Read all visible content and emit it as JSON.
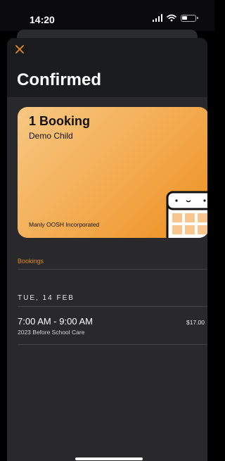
{
  "status_bar": {
    "time": "14:20"
  },
  "header": {
    "title": "Confirmed",
    "close_icon": "close-icon"
  },
  "card": {
    "title": "1 Booking",
    "subtitle": "Demo Child",
    "organization": "Manly OOSH Incorporated",
    "gradient_colors": [
      "#f7c883",
      "#f3aa4e",
      "#ee8f1f"
    ]
  },
  "bookings": {
    "section_label": "Bookings",
    "date": "TUE, 14 FEB",
    "item": {
      "time": "7:00 AM - 9:00 AM",
      "program": "2023 Before School Care",
      "price": "$17.00"
    }
  },
  "colors": {
    "accent": "#e38a1e",
    "background": "#29292b"
  }
}
